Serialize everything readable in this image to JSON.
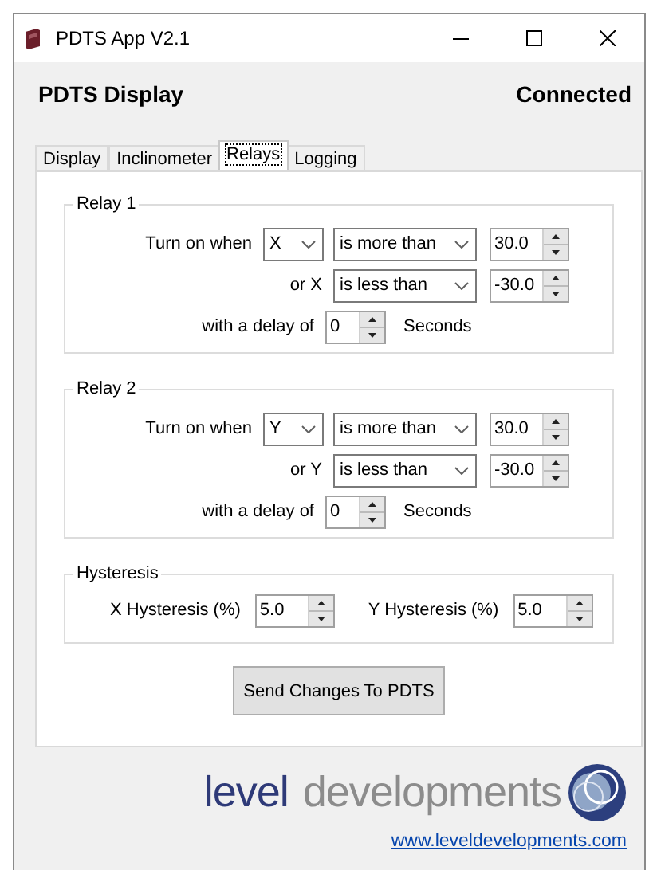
{
  "window": {
    "title": "PDTS App V2.1"
  },
  "header": {
    "title": "PDTS Display",
    "status": "Connected"
  },
  "tabs": [
    {
      "label": "Display",
      "selected": false
    },
    {
      "label": "Inclinometer",
      "selected": false
    },
    {
      "label": "Relays",
      "selected": true
    },
    {
      "label": "Logging",
      "selected": false
    }
  ],
  "relays": [
    {
      "title": "Relay 1",
      "rows": [
        {
          "kind": "when",
          "label": "Turn on when",
          "axis": "X",
          "comparison": "is more than",
          "threshold": "30.0"
        },
        {
          "kind": "or",
          "label": "or X",
          "comparison": "is less than",
          "threshold": "-30.0"
        },
        {
          "kind": "delay",
          "label": "with a delay of",
          "value": "0",
          "unit": "Seconds"
        }
      ]
    },
    {
      "title": "Relay 2",
      "rows": [
        {
          "kind": "when",
          "label": "Turn on when",
          "axis": "Y",
          "comparison": "is more than",
          "threshold": "30.0"
        },
        {
          "kind": "or",
          "label": "or Y",
          "comparison": "is less than",
          "threshold": "-30.0"
        },
        {
          "kind": "delay",
          "label": "with a delay of",
          "value": "0",
          "unit": "Seconds"
        }
      ]
    }
  ],
  "hysteresis": {
    "title": "Hysteresis",
    "fields": [
      {
        "label": "X Hysteresis (%)",
        "value": "5.0"
      },
      {
        "label": "Y Hysteresis (%)",
        "value": "5.0"
      }
    ]
  },
  "send_button": "Send Changes To PDTS",
  "footer": {
    "logo": [
      "level",
      "developments"
    ],
    "link": "www.leveldevelopments.com"
  }
}
